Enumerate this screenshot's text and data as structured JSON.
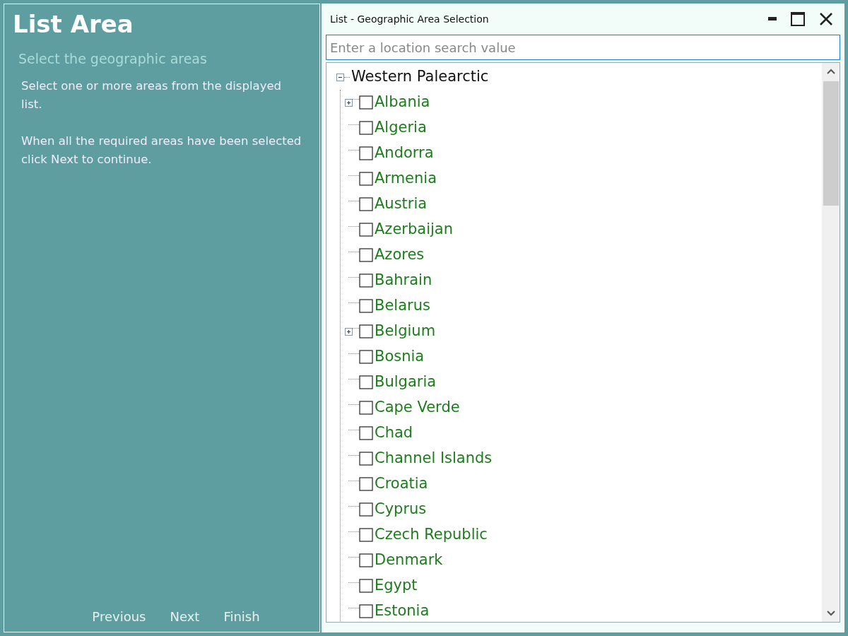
{
  "wizard": {
    "title": "List Area",
    "subtitle": "Select the geographic areas",
    "instructions": [
      "Select one or more areas from the displayed list.",
      "When all the required areas have been selected click Next to continue."
    ],
    "buttons": [
      "Previous",
      "Next",
      "Finish"
    ]
  },
  "dialog": {
    "title": "List - Geographic Area Selection",
    "search": {
      "placeholder": "Enter a location search value"
    },
    "tree": [
      {
        "label": "Western Palearctic",
        "expanded": true,
        "children": [
          {
            "label": "Albania",
            "checked": false,
            "expanded": false
          },
          {
            "label": "Algeria",
            "checked": false
          },
          {
            "label": "Andorra",
            "checked": false
          },
          {
            "label": "Armenia",
            "checked": false
          },
          {
            "label": "Austria",
            "checked": false
          },
          {
            "label": "Azerbaijan",
            "checked": false
          },
          {
            "label": "Azores",
            "checked": false
          },
          {
            "label": "Bahrain",
            "checked": false
          },
          {
            "label": "Belarus",
            "checked": false
          },
          {
            "label": "Belgium",
            "checked": false,
            "expanded": false
          },
          {
            "label": "Bosnia",
            "checked": false
          },
          {
            "label": "Bulgaria",
            "checked": false
          },
          {
            "label": "Cape Verde",
            "checked": false
          },
          {
            "label": "Chad",
            "checked": false
          },
          {
            "label": "Channel Islands",
            "checked": false
          },
          {
            "label": "Croatia",
            "checked": false
          },
          {
            "label": "Cyprus",
            "checked": false
          },
          {
            "label": "Czech Republic",
            "checked": false
          },
          {
            "label": "Denmark",
            "checked": false
          },
          {
            "label": "Egypt",
            "checked": false
          },
          {
            "label": "Estonia",
            "checked": false
          }
        ]
      }
    ]
  }
}
